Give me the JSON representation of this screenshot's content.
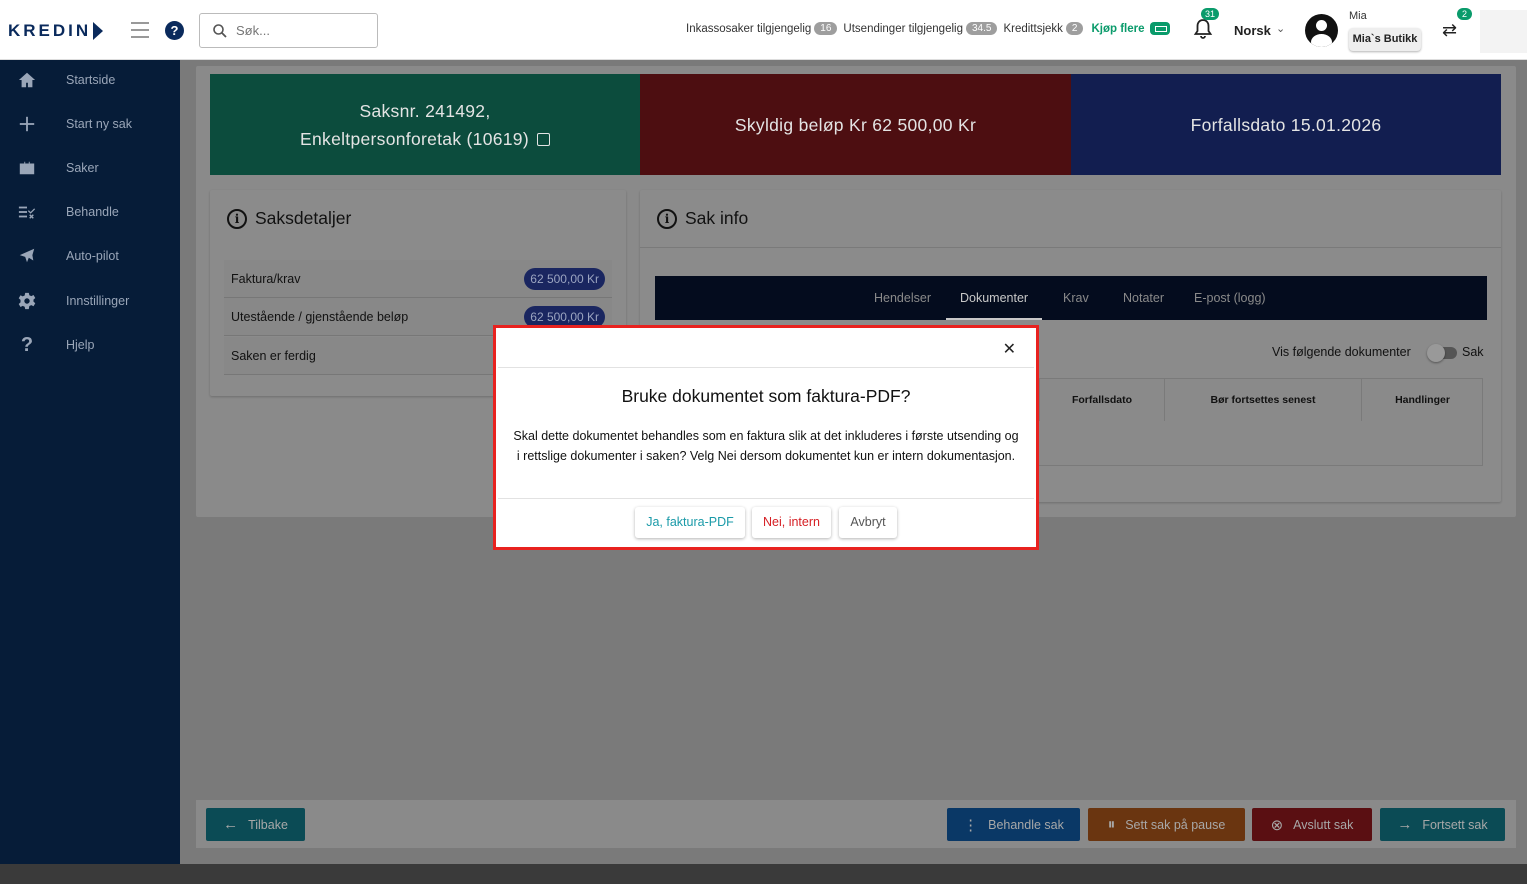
{
  "header": {
    "logo_text": "KREDIN",
    "search_placeholder": "Søk...",
    "stats": [
      {
        "label": "Inkassosaker tilgjengelig",
        "value": "16"
      },
      {
        "label": "Utsendinger tilgjengelig",
        "value": "34.5"
      },
      {
        "label": "Kredittsjekk",
        "value": "2"
      }
    ],
    "buy_more": "Kjøp flere",
    "notifications_count": "31",
    "language": "Norsk",
    "user_name": "Mia",
    "shop_name": "Mia`s Butikk",
    "switch_count": "2"
  },
  "sidebar": {
    "items": [
      {
        "label": "Startside",
        "icon": "home-icon"
      },
      {
        "label": "Start ny sak",
        "icon": "plus-icon"
      },
      {
        "label": "Saker",
        "icon": "briefcase-icon"
      },
      {
        "label": "Behandle",
        "icon": "checklist-icon"
      },
      {
        "label": "Auto-pilot",
        "icon": "airplane-icon"
      },
      {
        "label": "Innstillinger",
        "icon": "gear-icon"
      },
      {
        "label": "Hjelp",
        "icon": "question-icon"
      }
    ]
  },
  "tiles": {
    "case_line1": "Saksnr. 241492,",
    "case_line2": "Enkeltpersonforetak (10619)",
    "debt": "Skyldig beløp Kr 62 500,00 Kr",
    "due": "Forfallsdato  15.01.2026",
    "colors": {
      "teal": "#0c4c3d",
      "red": "#4d0e11",
      "blue": "#121e50"
    }
  },
  "details": {
    "title": "Saksdetaljer",
    "rows": [
      {
        "label": "Faktura/krav",
        "value": "62 500,00 Kr"
      },
      {
        "label": "Utestående / gjenstående beløp",
        "value": "62 500,00 Kr"
      },
      {
        "label": "Saken er ferdig",
        "value": ""
      }
    ]
  },
  "sak_info": {
    "title": "Sak info",
    "tabs": [
      "Hendelser",
      "Dokumenter",
      "Krav",
      "Notater",
      "E-post (logg)"
    ],
    "active_tab": "Dokumenter",
    "toggle_label": "Vis følgende dokumenter",
    "toggle_right": "Sak",
    "columns": [
      "Forfallsdato",
      "Bør fortsettes senest",
      "Handlinger"
    ]
  },
  "footer": {
    "back": "Tilbake",
    "process": "Behandle sak",
    "pause": "Sett sak på pause",
    "close": "Avslutt sak",
    "continue": "Fortsett sak"
  },
  "modal": {
    "title": "Bruke dokumentet som faktura-PDF?",
    "body": "Skal dette dokumentet behandles som en faktura slik at det inkluderes i første utsending og i rettslige dokumenter i saken? Velg Nei dersom dokumentet kun er intern dokumentasjon.",
    "yes": "Ja, faktura-PDF",
    "no": "Nei, intern",
    "cancel": "Avbryt",
    "highlight_color": "#e8221f"
  }
}
